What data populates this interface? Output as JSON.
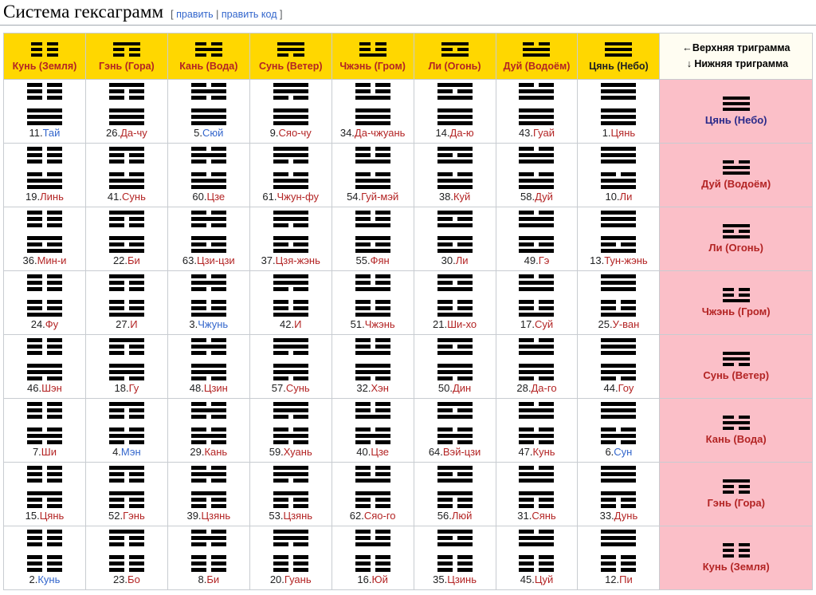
{
  "heading": {
    "title": "Система гексаграмм",
    "bracket_open": "[",
    "edit": "править",
    "separator": "|",
    "edit_source": "править код",
    "bracket_close": "]"
  },
  "corner": {
    "upper_arrow": "←",
    "upper_text": "Верхняя триграмма",
    "lower_arrow": "↓",
    "lower_text": "Нижняя триграмма"
  },
  "colors": {
    "header_bg": "#FFD700",
    "side_bg": "#FBBFC8",
    "corner_bg": "#fffdf2",
    "link_red": "#b32424",
    "link_blue": "#3366cc",
    "link_purple": "#2a2a8a",
    "border": "#c8ccd1"
  },
  "columns": [
    {
      "name": "Кунь (Земля)",
      "bits": "000",
      "color": "red"
    },
    {
      "name": "Гэнь (Гора)",
      "bits": "001",
      "color": "red"
    },
    {
      "name": "Кань (Вода)",
      "bits": "010",
      "color": "red"
    },
    {
      "name": "Сунь (Ветер)",
      "bits": "011",
      "color": "red"
    },
    {
      "name": "Чжэнь (Гром)",
      "bits": "100",
      "color": "red"
    },
    {
      "name": "Ли (Огонь)",
      "bits": "101",
      "color": "red"
    },
    {
      "name": "Дуй (Водоём)",
      "bits": "110",
      "color": "red"
    },
    {
      "name": "Цянь (Небо)",
      "bits": "111",
      "color": "dark"
    }
  ],
  "rows": [
    {
      "name": "Цянь (Небо)",
      "bits": "111",
      "color": "purple"
    },
    {
      "name": "Дуй (Водоём)",
      "bits": "110",
      "color": "red"
    },
    {
      "name": "Ли (Огонь)",
      "bits": "101",
      "color": "red"
    },
    {
      "name": "Чжэнь (Гром)",
      "bits": "100",
      "color": "red"
    },
    {
      "name": "Сунь (Ветер)",
      "bits": "011",
      "color": "red"
    },
    {
      "name": "Кань (Вода)",
      "bits": "010",
      "color": "red"
    },
    {
      "name": "Гэнь (Гора)",
      "bits": "001",
      "color": "red"
    },
    {
      "name": "Кунь (Земля)",
      "bits": "000",
      "color": "red"
    }
  ],
  "cells": [
    [
      {
        "num": "11.",
        "name": "Тай",
        "color": "blue"
      },
      {
        "num": "26.",
        "name": "Да-чу",
        "color": "red"
      },
      {
        "num": "5.",
        "name": "Сюй",
        "color": "blue"
      },
      {
        "num": "9.",
        "name": "Сяо-чу",
        "color": "red"
      },
      {
        "num": "34.",
        "name": "Да-чжуань",
        "color": "red"
      },
      {
        "num": "14.",
        "name": "Да-ю",
        "color": "red"
      },
      {
        "num": "43.",
        "name": "Гуай",
        "color": "red"
      },
      {
        "num": "1.",
        "name": "Цянь",
        "color": "red"
      }
    ],
    [
      {
        "num": "19.",
        "name": "Линь",
        "color": "red"
      },
      {
        "num": "41.",
        "name": "Сунь",
        "color": "red"
      },
      {
        "num": "60.",
        "name": "Цзе",
        "color": "red"
      },
      {
        "num": "61.",
        "name": "Чжун-фу",
        "color": "red"
      },
      {
        "num": "54.",
        "name": "Гуй-мэй",
        "color": "red"
      },
      {
        "num": "38.",
        "name": "Куй",
        "color": "red"
      },
      {
        "num": "58.",
        "name": "Дуй",
        "color": "red"
      },
      {
        "num": "10.",
        "name": "Ли",
        "color": "red"
      }
    ],
    [
      {
        "num": "36.",
        "name": "Мин-и",
        "color": "red"
      },
      {
        "num": "22.",
        "name": "Би",
        "color": "red"
      },
      {
        "num": "63.",
        "name": "Цзи-цзи",
        "color": "red"
      },
      {
        "num": "37.",
        "name": "Цзя-жэнь",
        "color": "red"
      },
      {
        "num": "55.",
        "name": "Фян",
        "color": "red"
      },
      {
        "num": "30.",
        "name": "Ли",
        "color": "red"
      },
      {
        "num": "49.",
        "name": "Гэ",
        "color": "red"
      },
      {
        "num": "13.",
        "name": "Тун-жэнь",
        "color": "red"
      }
    ],
    [
      {
        "num": "24.",
        "name": "Фу",
        "color": "red"
      },
      {
        "num": "27.",
        "name": "И",
        "color": "red"
      },
      {
        "num": "3.",
        "name": "Чжунь",
        "color": "blue"
      },
      {
        "num": "42.",
        "name": "И",
        "color": "red"
      },
      {
        "num": "51.",
        "name": "Чжэнь",
        "color": "red"
      },
      {
        "num": "21.",
        "name": "Ши-хо",
        "color": "red"
      },
      {
        "num": "17.",
        "name": "Суй",
        "color": "red"
      },
      {
        "num": "25.",
        "name": "У-ван",
        "color": "red"
      }
    ],
    [
      {
        "num": "46.",
        "name": "Шэн",
        "color": "red"
      },
      {
        "num": "18.",
        "name": "Гу",
        "color": "red"
      },
      {
        "num": "48.",
        "name": "Цзин",
        "color": "red"
      },
      {
        "num": "57.",
        "name": "Сунь",
        "color": "red"
      },
      {
        "num": "32.",
        "name": "Хэн",
        "color": "red"
      },
      {
        "num": "50.",
        "name": "Дин",
        "color": "red"
      },
      {
        "num": "28.",
        "name": "Да-го",
        "color": "red"
      },
      {
        "num": "44.",
        "name": "Гоу",
        "color": "red"
      }
    ],
    [
      {
        "num": "7.",
        "name": "Ши",
        "color": "red"
      },
      {
        "num": "4.",
        "name": "Мэн",
        "color": "blue"
      },
      {
        "num": "29.",
        "name": "Кань",
        "color": "red"
      },
      {
        "num": "59.",
        "name": "Хуань",
        "color": "red"
      },
      {
        "num": "40.",
        "name": "Цзе",
        "color": "red"
      },
      {
        "num": "64.",
        "name": "Вэй-цзи",
        "color": "red"
      },
      {
        "num": "47.",
        "name": "Кунь",
        "color": "red"
      },
      {
        "num": "6.",
        "name": "Сун",
        "color": "blue"
      }
    ],
    [
      {
        "num": "15.",
        "name": "Цянь",
        "color": "red"
      },
      {
        "num": "52.",
        "name": "Гэнь",
        "color": "red"
      },
      {
        "num": "39.",
        "name": "Цзянь",
        "color": "red"
      },
      {
        "num": "53.",
        "name": "Цзянь",
        "color": "red"
      },
      {
        "num": "62.",
        "name": "Сяо-го",
        "color": "red"
      },
      {
        "num": "56.",
        "name": "Люй",
        "color": "red"
      },
      {
        "num": "31.",
        "name": "Сянь",
        "color": "red"
      },
      {
        "num": "33.",
        "name": "Дунь",
        "color": "red"
      }
    ],
    [
      {
        "num": "2.",
        "name": "Кунь",
        "color": "blue"
      },
      {
        "num": "23.",
        "name": "Бо",
        "color": "red"
      },
      {
        "num": "8.",
        "name": "Би",
        "color": "red"
      },
      {
        "num": "20.",
        "name": "Гуань",
        "color": "red"
      },
      {
        "num": "16.",
        "name": "Юй",
        "color": "red"
      },
      {
        "num": "35.",
        "name": "Цзинь",
        "color": "red"
      },
      {
        "num": "45.",
        "name": "Цуй",
        "color": "red"
      },
      {
        "num": "12.",
        "name": "Пи",
        "color": "red"
      }
    ]
  ]
}
